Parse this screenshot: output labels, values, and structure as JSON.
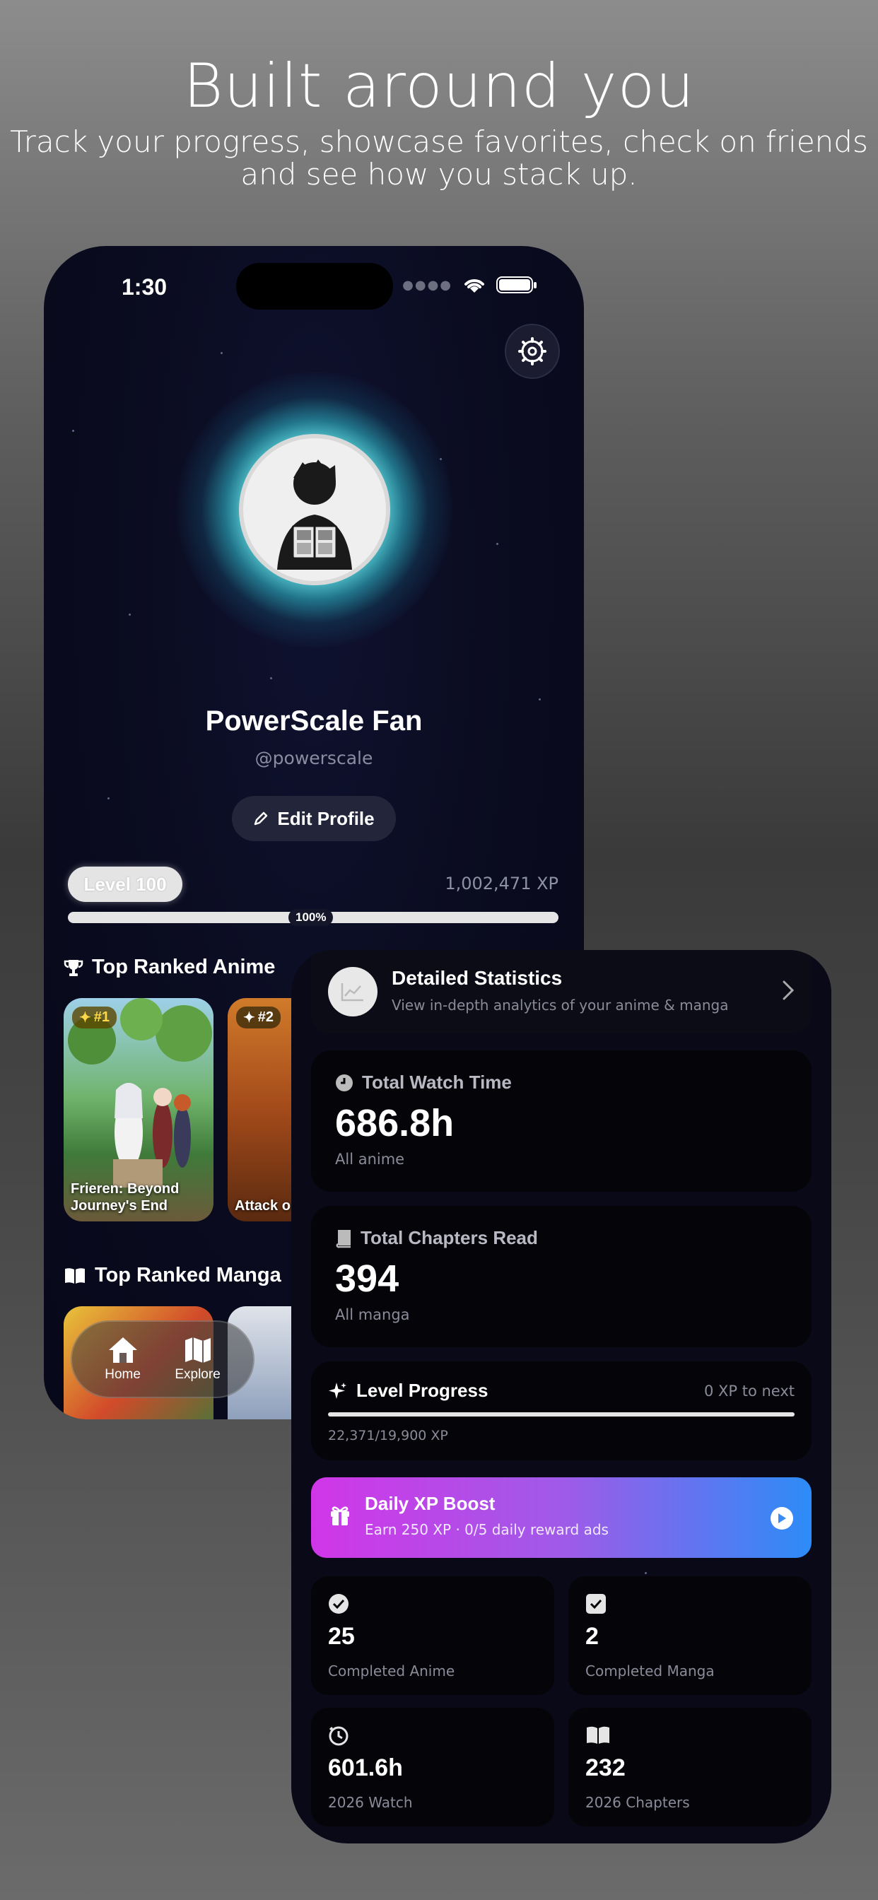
{
  "hero": {
    "title": "Built around you",
    "subtitle": "Track your progress, showcase favorites, check on friends and see how you stack up."
  },
  "status_bar": {
    "time": "1:30"
  },
  "profile": {
    "name": "PowerScale Fan",
    "handle": "@powerscale",
    "edit_label": "Edit Profile",
    "level_label": "Level 100",
    "xp_total": "1,002,471 XP",
    "progress_label": "100%",
    "progress_fraction": 1.0
  },
  "top_anime": {
    "title": "Top Ranked Anime",
    "items": [
      {
        "rank": "#1",
        "title": "Frieren: Beyond Journey's End"
      },
      {
        "rank": "#2",
        "title": "Attack o"
      }
    ]
  },
  "top_manga": {
    "title": "Top Ranked Manga"
  },
  "tabbar": {
    "home": "Home",
    "explore": "Explore"
  },
  "stats": {
    "detailed": {
      "title": "Detailed Statistics",
      "subtitle": "View in-depth analytics of your anime & manga"
    },
    "watch_time": {
      "title": "Total Watch Time",
      "value": "686.8h",
      "caption": "All anime"
    },
    "chapters": {
      "title": "Total Chapters Read",
      "value": "394",
      "caption": "All manga"
    },
    "level_progress": {
      "title": "Level Progress",
      "next": "0 XP to next",
      "detail": "22,371/19,900 XP",
      "fraction": 1.0
    },
    "boost": {
      "title": "Daily XP Boost",
      "subtitle": "Earn 250 XP · 0/5 daily reward ads"
    },
    "completed_anime": {
      "value": "25",
      "label": "Completed Anime"
    },
    "completed_manga": {
      "value": "2",
      "label": "Completed Manga"
    },
    "watch_2026": {
      "value": "601.6h",
      "label": "2026 Watch"
    },
    "chapters_2026": {
      "value": "232",
      "label": "2026 Chapters"
    }
  },
  "colors": {
    "boost_gradient_start": "#d136e8",
    "boost_gradient_end": "#2c8cf7",
    "aura": "#5fdce1"
  }
}
